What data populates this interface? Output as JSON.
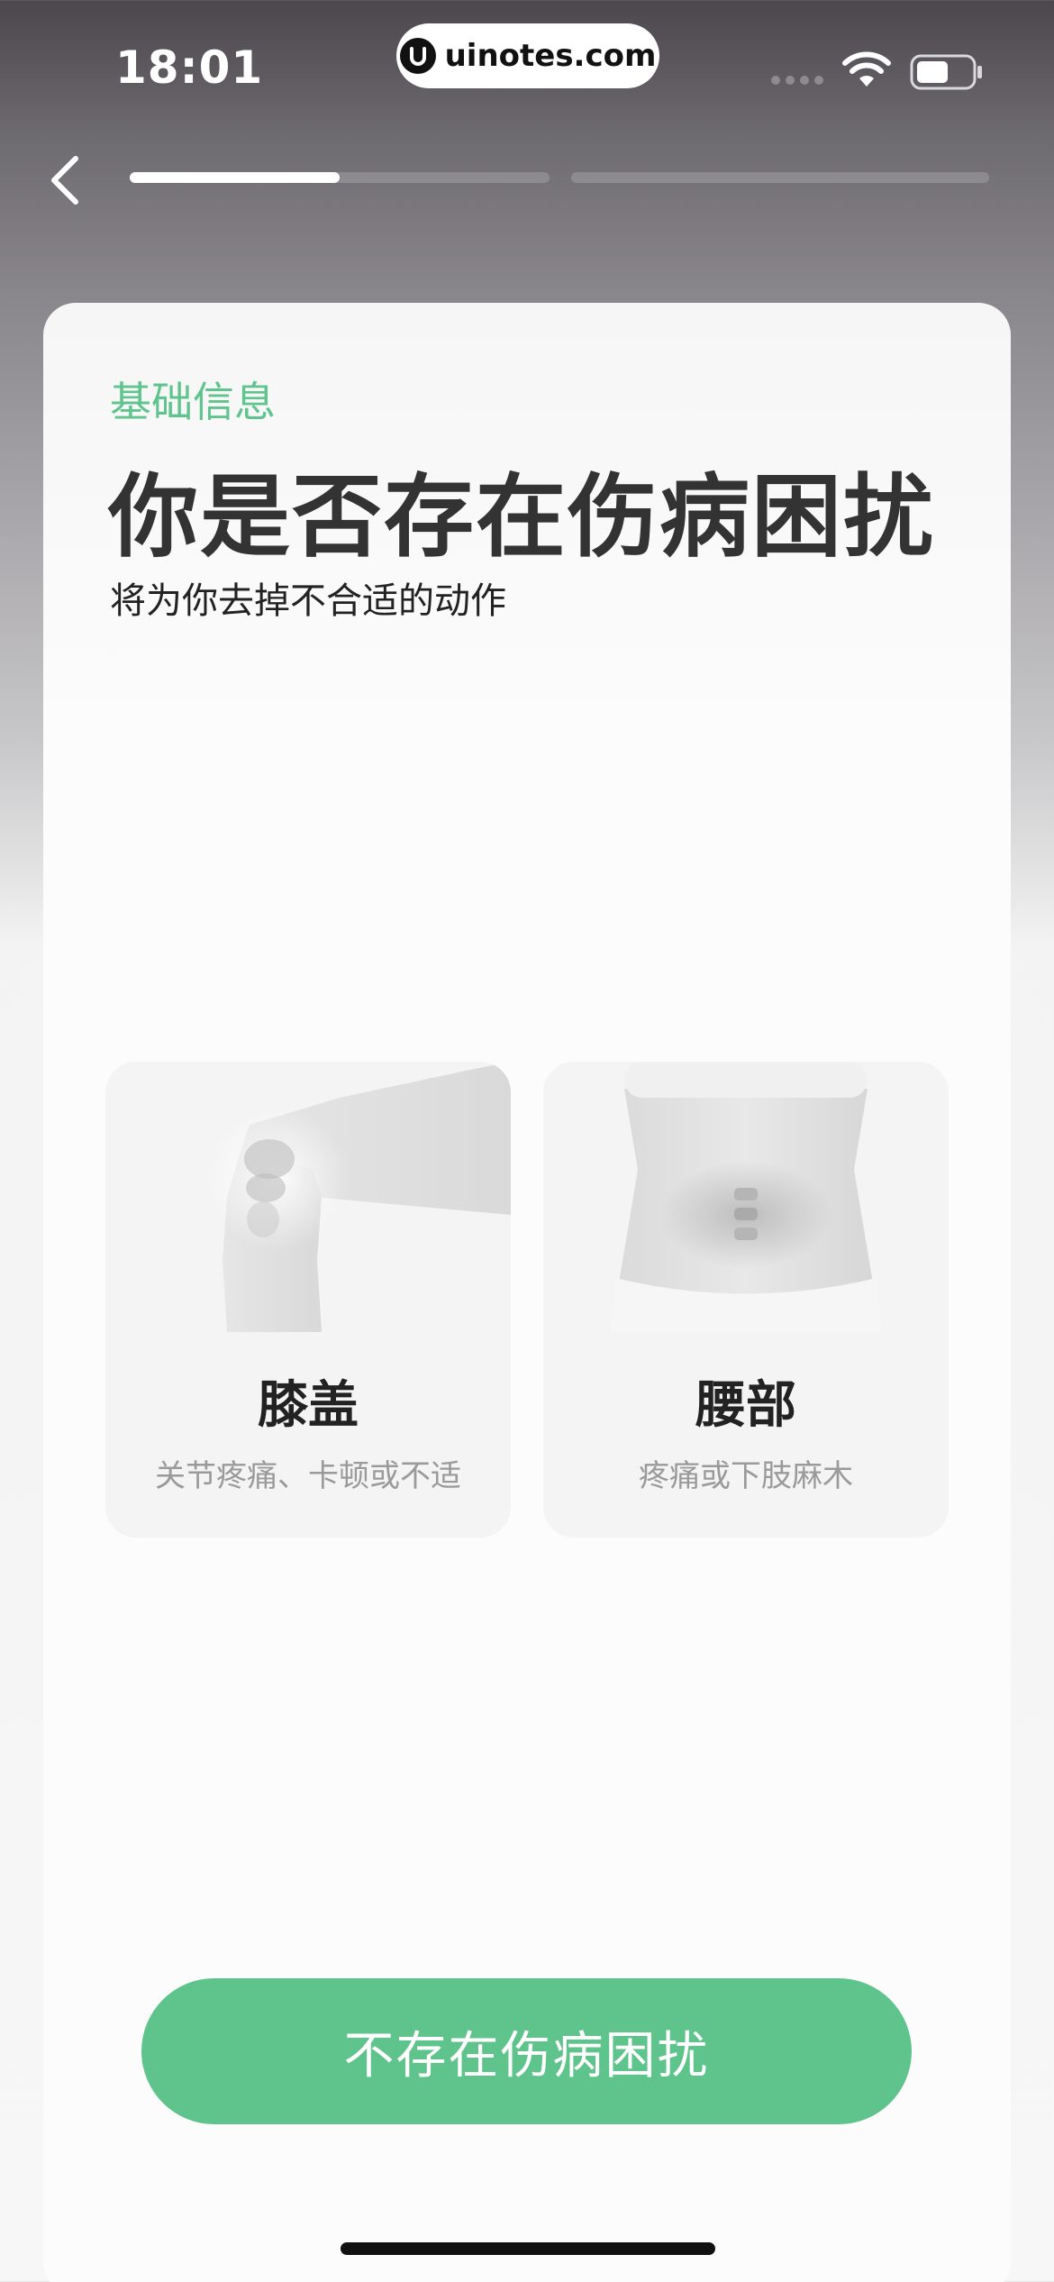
{
  "status_bar": {
    "time": "18:01",
    "url": "uinotes.com",
    "icons": [
      "cellular-signal-icon",
      "wifi-icon",
      "battery-icon"
    ]
  },
  "nav": {
    "back_icon": "chevron-left-icon",
    "progress": [
      {
        "step": 1,
        "fill_fraction": 0.5
      },
      {
        "step": 2,
        "fill_fraction": 0.0
      }
    ]
  },
  "header": {
    "section_label": "基础信息",
    "title": "你是否存在伤病困扰",
    "subtitle": "将为你去掉不合适的动作"
  },
  "options": [
    {
      "label": "膝盖",
      "description": "关节疼痛、卡顿或不适",
      "icon": "knee-illustration"
    },
    {
      "label": "腰部",
      "description": "疼痛或下肢麻木",
      "icon": "waist-illustration"
    }
  ],
  "primary_button": {
    "label": "不存在伤病困扰"
  },
  "colors": {
    "accent": "#5fc48c",
    "title_text": "#333333",
    "muted_text": "#9a9a9a",
    "card_background": "#fcfcfc"
  }
}
